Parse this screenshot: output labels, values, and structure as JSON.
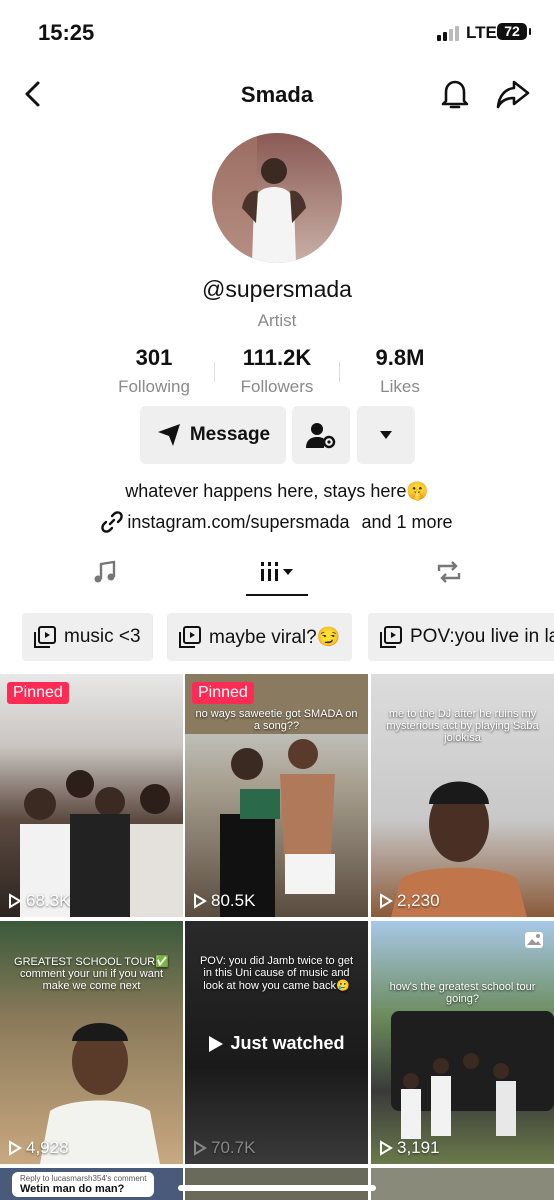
{
  "status": {
    "time": "15:25",
    "network": "LTE",
    "battery": "72"
  },
  "header": {
    "title": "Smada"
  },
  "profile": {
    "handle": "@supersmada",
    "category": "Artist",
    "stats": [
      {
        "value": "301",
        "label": "Following"
      },
      {
        "value": "111.2K",
        "label": "Followers"
      },
      {
        "value": "9.8M",
        "label": "Likes"
      }
    ],
    "message_label": "Message",
    "bio": "whatever happens here, stays here🤫",
    "link": "instagram.com/supersmada",
    "link_more": "and 1 more"
  },
  "playlists": [
    {
      "label": "music <3"
    },
    {
      "label": "maybe viral?😏"
    },
    {
      "label": "POV:you live in la"
    }
  ],
  "videos": [
    {
      "views": "68.3K",
      "badge": "Pinned",
      "caption": ""
    },
    {
      "views": "80.5K",
      "badge": "Pinned",
      "caption": "no ways saweetie got SMADA on a song??"
    },
    {
      "views": "2,230",
      "badge": "",
      "caption": "me to the DJ after he ruins my mysterious act by playing Saba jolokisa"
    },
    {
      "views": "4,928",
      "badge": "",
      "caption": "GREATEST SCHOOL TOUR✅ comment your uni if you want make we come next"
    },
    {
      "views": "70.7K",
      "badge": "",
      "caption": "POV: you did Jamb twice to get in this Uni cause of music and look at how you came back🥲",
      "watched": "Just watched"
    },
    {
      "views": "3,191",
      "badge": "",
      "caption": "how's the greatest school tour going?"
    }
  ],
  "bottom_row": {
    "reply_caption": "Reply to lucasmarsh354's comment",
    "reply_text": "Wetin man do man?"
  },
  "colors": {
    "pinned": "#fe2c55",
    "button_bg": "#efefef",
    "muted": "#8a8a8a"
  }
}
